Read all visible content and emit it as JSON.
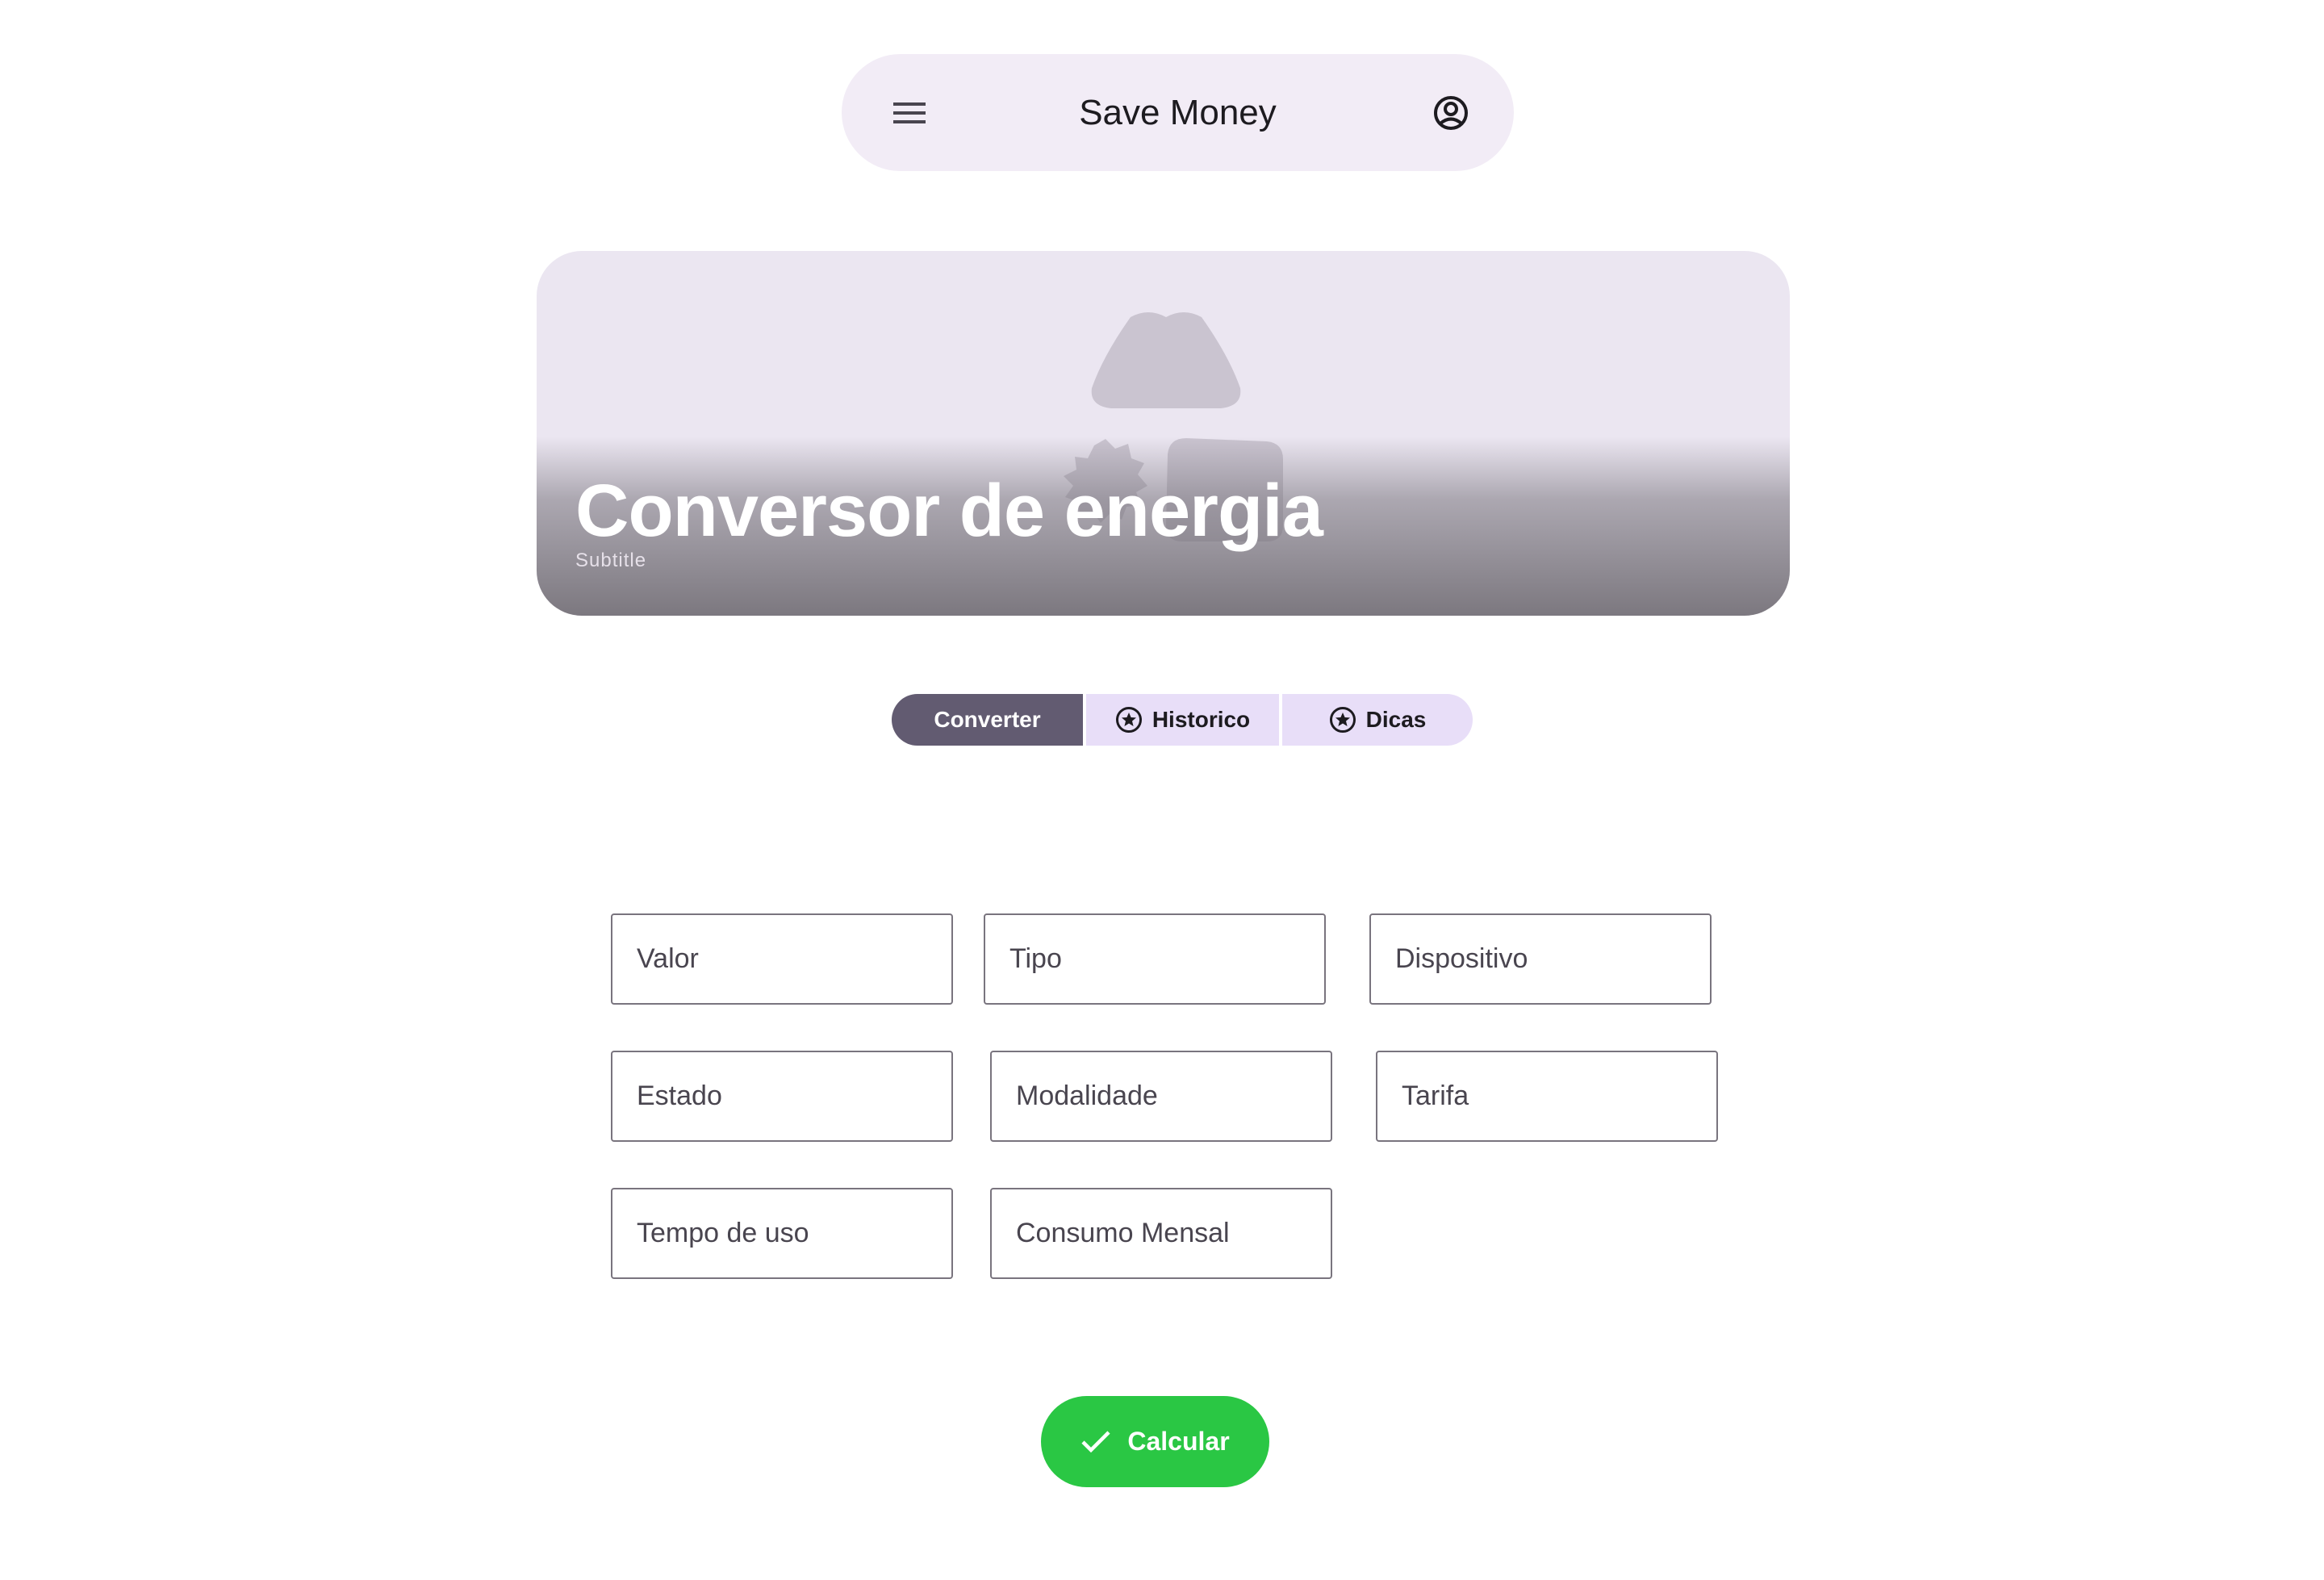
{
  "app_bar": {
    "title": "Save Money",
    "menu_icon": "menu-icon",
    "account_icon": "account-circle-icon"
  },
  "hero": {
    "title": "Conversor de energia",
    "subtitle": "Subtitle"
  },
  "tabs": [
    {
      "label": "Converter",
      "active": true
    },
    {
      "label": "Historico",
      "active": false,
      "icon": "star-circle-icon"
    },
    {
      "label": "Dicas",
      "active": false,
      "icon": "star-circle-icon"
    }
  ],
  "fields": {
    "valor": {
      "placeholder": "Valor",
      "value": ""
    },
    "tipo": {
      "placeholder": "Tipo",
      "value": ""
    },
    "dispositivo": {
      "placeholder": "Dispositivo",
      "value": ""
    },
    "estado": {
      "placeholder": "Estado",
      "value": ""
    },
    "modalidade": {
      "placeholder": "Modalidade",
      "value": ""
    },
    "tarifa": {
      "placeholder": "Tarifa",
      "value": ""
    },
    "tempo_de_uso": {
      "placeholder": "Tempo de uso",
      "value": ""
    },
    "consumo_mensal": {
      "placeholder": "Consumo Mensal",
      "value": ""
    }
  },
  "calculate_button": {
    "label": "Calcular",
    "icon": "check-icon"
  },
  "colors": {
    "app_bar_bg": "#f2ecf6",
    "tab_active_bg": "#625b71",
    "tab_inactive_bg": "#e8def8",
    "calculate_bg": "#2ac744",
    "field_border": "#79747e"
  }
}
